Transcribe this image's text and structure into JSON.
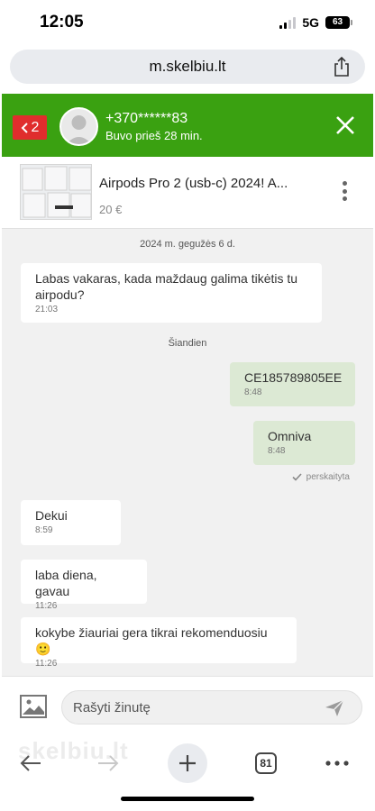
{
  "status_bar": {
    "time": "12:05",
    "network": "5G",
    "battery": "63"
  },
  "browser": {
    "url": "m.skelbiu.lt",
    "tab_count": "81",
    "watermark": "skelbiu.lt"
  },
  "chat_header": {
    "back_count": "2",
    "contact": "+370******83",
    "last_seen": "Buvo prieš 28 min.",
    "accent": "#3aa111"
  },
  "listing": {
    "title": "Airpods Pro 2 (usb-c) 2024! A...",
    "price": "20 €"
  },
  "messages": {
    "date_1": "2024 m. gegužės 6 d.",
    "date_2": "Šiandien",
    "items": [
      {
        "text": "Labas vakaras, kada maždaug galima tikėtis tu airpodu?",
        "time": "21:03"
      },
      {
        "text": "CE185789805EE",
        "time": "8:48"
      },
      {
        "text": "Omniva",
        "time": "8:48"
      },
      {
        "text": "Dekui",
        "time": "8:59"
      },
      {
        "text": "laba diena, gavau",
        "time": "11:26"
      },
      {
        "text": "kokybe žiauriai gera tikrai rekomenduosiu 🙂",
        "time": "11:26"
      }
    ],
    "read_status": "perskaityta"
  },
  "compose": {
    "placeholder": "Rašyti žinutę"
  },
  "icons": [
    "share-icon",
    "chevron-left-icon",
    "avatar-icon",
    "close-icon",
    "kebab-menu-icon",
    "check-icon",
    "image-icon",
    "send-icon",
    "back-arrow-icon",
    "forward-arrow-icon",
    "plus-icon",
    "tabs-icon",
    "more-icon"
  ]
}
